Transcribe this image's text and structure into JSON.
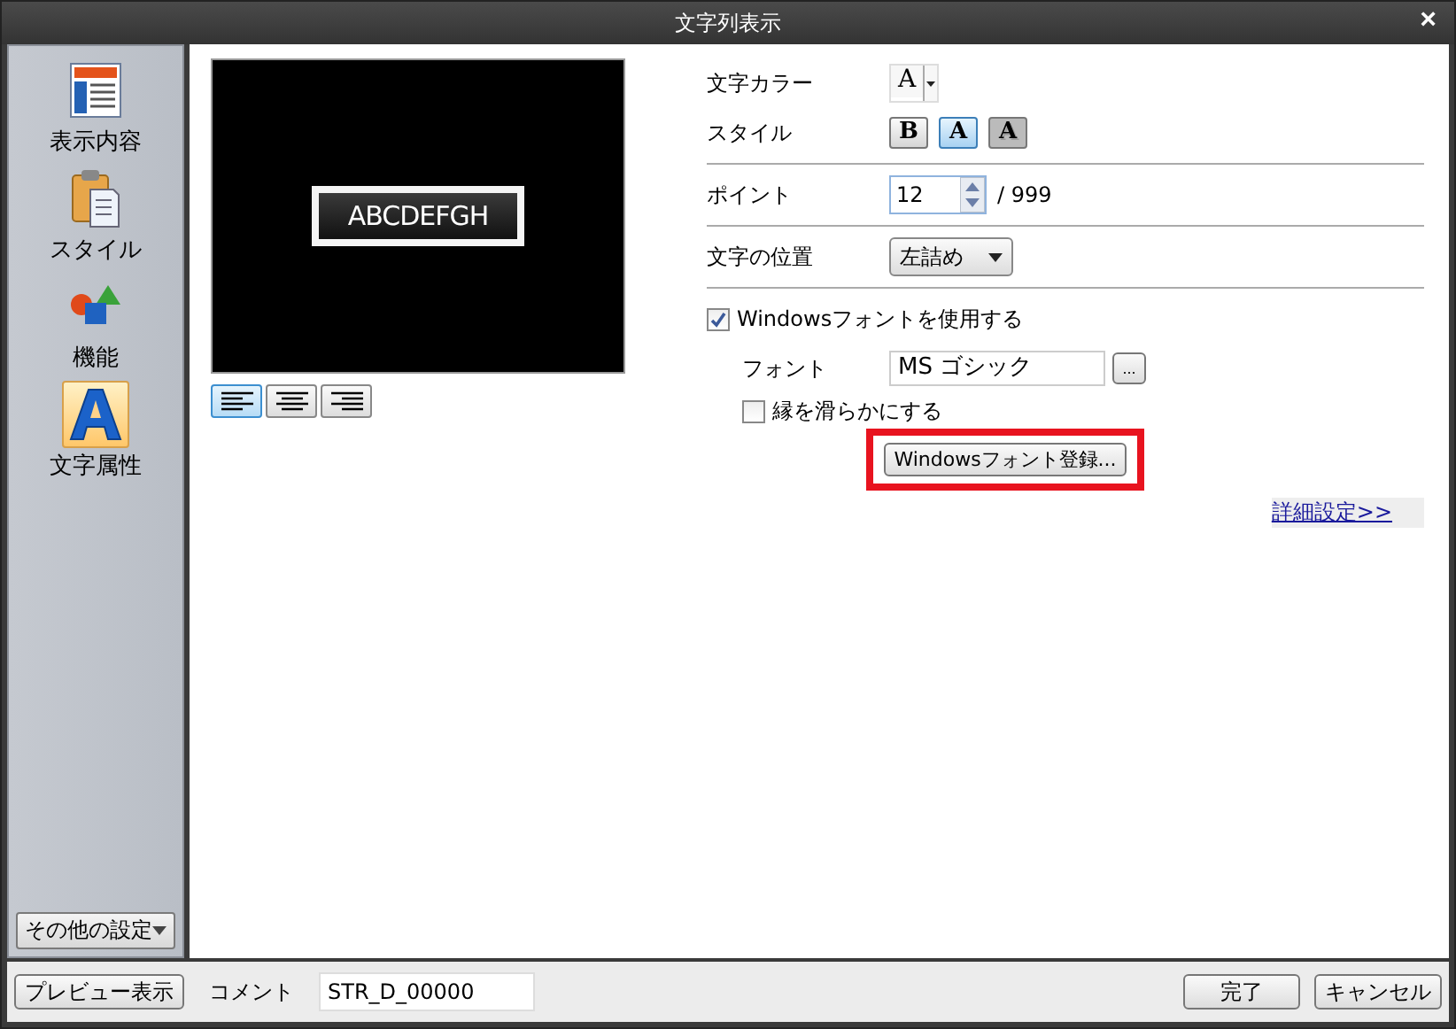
{
  "window": {
    "title": "文字列表示",
    "close": "×"
  },
  "sidebar": {
    "items": [
      {
        "label": "表示内容",
        "kind": "content",
        "selected": false
      },
      {
        "label": "スタイル",
        "kind": "style",
        "selected": false
      },
      {
        "label": "機能",
        "kind": "function",
        "selected": false
      },
      {
        "label": "文字属性",
        "kind": "text",
        "selected": true
      }
    ],
    "more_button": "その他の設定"
  },
  "preview": {
    "sample_text": "ABCDEFGH"
  },
  "align_buttons": [
    {
      "kind": "left",
      "selected": true
    },
    {
      "kind": "center",
      "selected": false
    },
    {
      "kind": "right",
      "selected": false
    }
  ],
  "text_color": {
    "label": "文字カラー",
    "glyph": "A"
  },
  "style": {
    "label": "スタイル",
    "buttons": [
      {
        "kind": "bold",
        "glyph": "B",
        "selected": false
      },
      {
        "kind": "normal",
        "glyph": "A",
        "selected": true
      },
      {
        "kind": "shadow",
        "glyph": "A",
        "selected": false
      }
    ]
  },
  "point": {
    "label": "ポイント",
    "value": "12",
    "max": "/ 999"
  },
  "position": {
    "label": "文字の位置",
    "value": "左詰め"
  },
  "windows_font": {
    "label": "Windowsフォントを使用する",
    "checked": true
  },
  "font": {
    "label": "フォント",
    "value": "MS ゴシック",
    "browse": "..."
  },
  "smooth": {
    "label": "縁を滑らかにする",
    "checked": false
  },
  "register_button": {
    "label": "Windowsフォント登録...",
    "highlighted": true
  },
  "details_link": "詳細設定>>",
  "footer": {
    "preview_button": "プレビュー表示",
    "comment_label": "コメント",
    "comment_value": "STR_D_00000",
    "ok_button": "完了",
    "cancel_button": "キャンセル"
  }
}
